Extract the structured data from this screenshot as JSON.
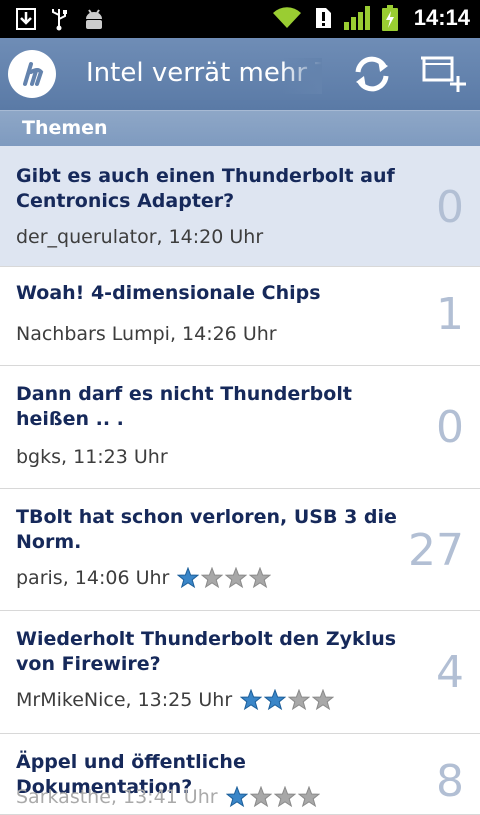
{
  "status_bar": {
    "time": "14:14",
    "left_icons": [
      "download-icon",
      "usb-icon",
      "android-debug-icon"
    ],
    "right_icons": [
      "wifi-icon",
      "alert-icon",
      "signal-icon",
      "battery-charging-icon"
    ]
  },
  "action_bar": {
    "logo_icon": "heise-logo-icon",
    "title": "Intel verrät mehr Thunderbolt",
    "refresh_icon": "refresh-icon",
    "new_topic_icon": "new-topic-icon"
  },
  "section": {
    "label": "Themen"
  },
  "colors": {
    "action_bar": "#6483ad",
    "section_header": "#8aa3c5",
    "selected_row": "#dee5f1",
    "title_text": "#16295a",
    "count_text": "#b2bfd4",
    "star_filled": "#3a86c8",
    "star_empty": "#a8a8a8"
  },
  "topics": [
    {
      "title": "Gibt es auch einen Thunderbolt auf Centronics Adapter?",
      "meta": "der_querulator, 14:20 Uhr",
      "count": "0",
      "rating": 0
    },
    {
      "title": "Woah! 4-dimensionale Chips",
      "meta": "Nachbars Lumpi, 14:26 Uhr",
      "count": "1",
      "rating": 0
    },
    {
      "title": "Dann darf es nicht Thunderbolt heißen .. .",
      "meta": "bgks, 11:23 Uhr",
      "count": "0",
      "rating": 0
    },
    {
      "title": "TBolt hat schon verloren, USB 3 die Norm.",
      "meta": "paris, 14:06 Uhr",
      "count": "27",
      "rating": 1
    },
    {
      "title": "Wiederholt Thunderbolt den Zyklus von Firewire?",
      "meta": "MrMikeNice, 13:25 Uhr",
      "count": "4",
      "rating": 2
    },
    {
      "title": "Äppel und öffentliche Dokumentation?",
      "meta": "Sarkasthe, 13:41 Uhr",
      "count": "8",
      "rating": 1
    }
  ]
}
